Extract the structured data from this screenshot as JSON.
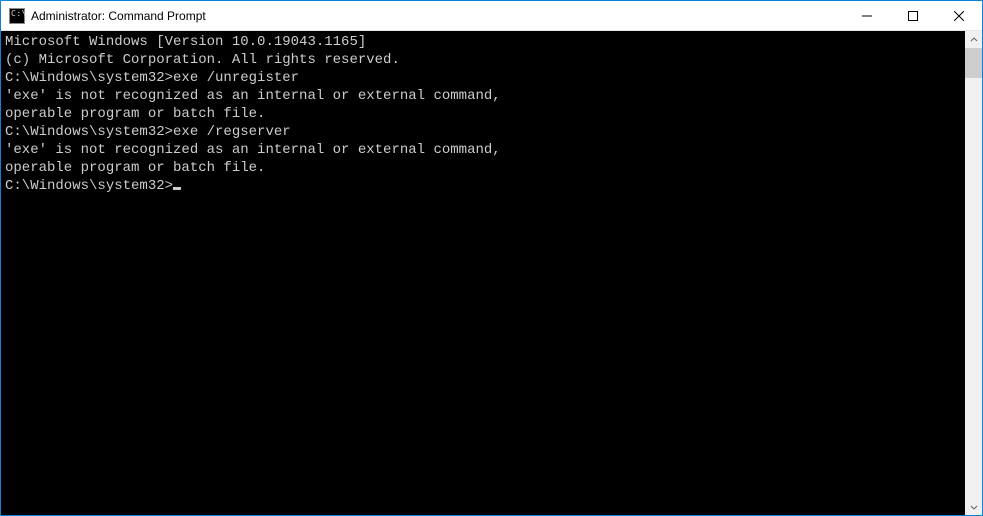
{
  "title": "Administrator: Command Prompt",
  "window_controls": {
    "minimize": "Minimize",
    "maximize": "Maximize",
    "close": "Close"
  },
  "console_lines": [
    "Microsoft Windows [Version 10.0.19043.1165]",
    "(c) Microsoft Corporation. All rights reserved.",
    "",
    "C:\\Windows\\system32>exe /unregister",
    "'exe' is not recognized as an internal or external command,",
    "operable program or batch file.",
    "",
    "C:\\Windows\\system32>exe /regserver",
    "'exe' is not recognized as an internal or external command,",
    "operable program or batch file.",
    "",
    "C:\\Windows\\system32>"
  ]
}
